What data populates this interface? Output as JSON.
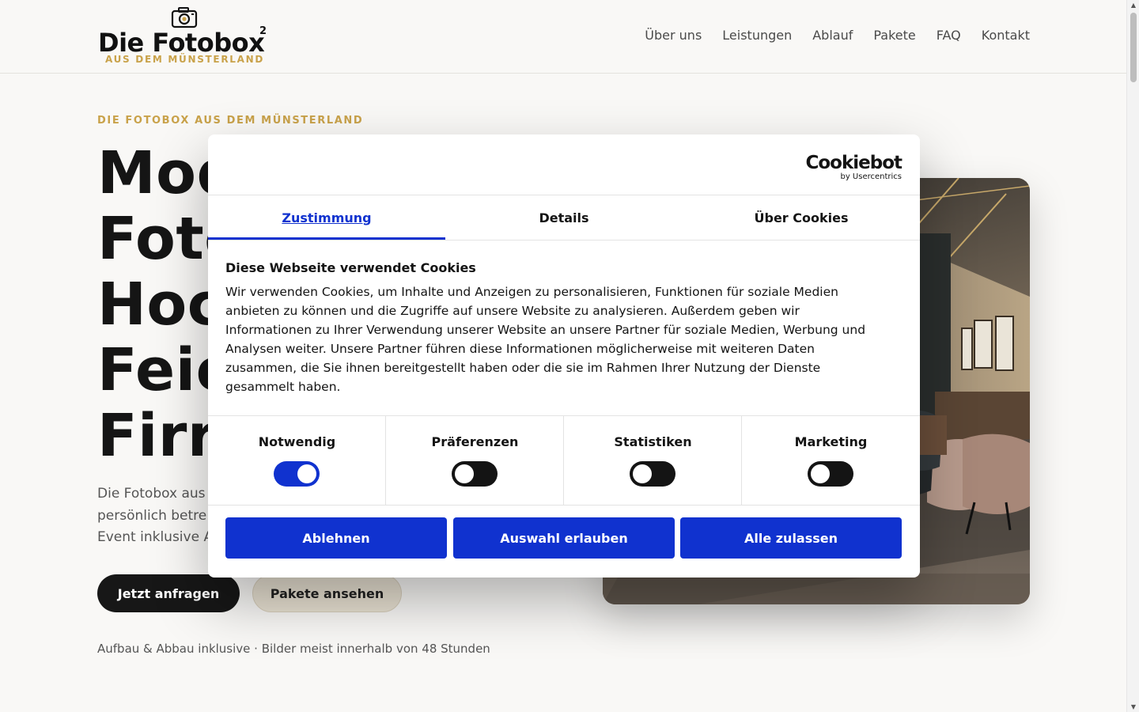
{
  "header": {
    "logo": {
      "title": "Die Fotobox",
      "superscript": "2",
      "subtitle": "AUS DEM MÜNSTERLAND"
    },
    "nav": [
      "Über uns",
      "Leistungen",
      "Ablauf",
      "Pakete",
      "FAQ",
      "Kontakt"
    ]
  },
  "hero": {
    "eyebrow": "DIE FOTOBOX AUS DEM MÜNSTERLAND",
    "headline_lines": [
      "Mod",
      "Fote",
      "Hoc",
      "Feie",
      "Firr"
    ],
    "lead_lines": [
      "Die Fotobox aus",
      "persönlich betre",
      "Event inklusive A"
    ],
    "primary_button": "Jetzt anfragen",
    "secondary_button": "Pakete ansehen",
    "note": "Aufbau & Abbau inklusive · Bilder meist innerhalb von 48 Stunden"
  },
  "cookie_dialog": {
    "brand": "Cookiebot",
    "brand_sub": "by Usercentrics",
    "tabs": [
      {
        "label": "Zustimmung",
        "active": true
      },
      {
        "label": "Details",
        "active": false
      },
      {
        "label": "Über Cookies",
        "active": false
      }
    ],
    "title": "Diese Webseite verwendet Cookies",
    "body_lines": [
      "Wir verwenden Cookies, um Inhalte und Anzeigen zu personalisieren, Funktionen für soziale Medien",
      "anbieten zu können und die Zugriffe auf unsere Website zu analysieren. Außerdem geben wir",
      "Informationen zu Ihrer Verwendung unserer Website an unsere Partner für soziale Medien, Werbung und",
      "Analysen weiter. Unsere Partner führen diese Informationen möglicherweise mit weiteren Daten",
      "zusammen, die Sie ihnen bereitgestellt haben oder die sie im Rahmen Ihrer Nutzung der Dienste",
      "gesammelt haben."
    ],
    "toggles": [
      {
        "label": "Notwendig",
        "on": true
      },
      {
        "label": "Präferenzen",
        "on": false
      },
      {
        "label": "Statistiken",
        "on": false
      },
      {
        "label": "Marketing",
        "on": false
      }
    ],
    "buttons": {
      "reject": "Ablehnen",
      "allow_selection": "Auswahl erlauben",
      "allow_all": "Alle zulassen"
    }
  },
  "colors": {
    "accent_gold": "#c9a24a",
    "cookie_blue": "#1032cf",
    "dark": "#171717",
    "background": "#f9f8f6"
  }
}
